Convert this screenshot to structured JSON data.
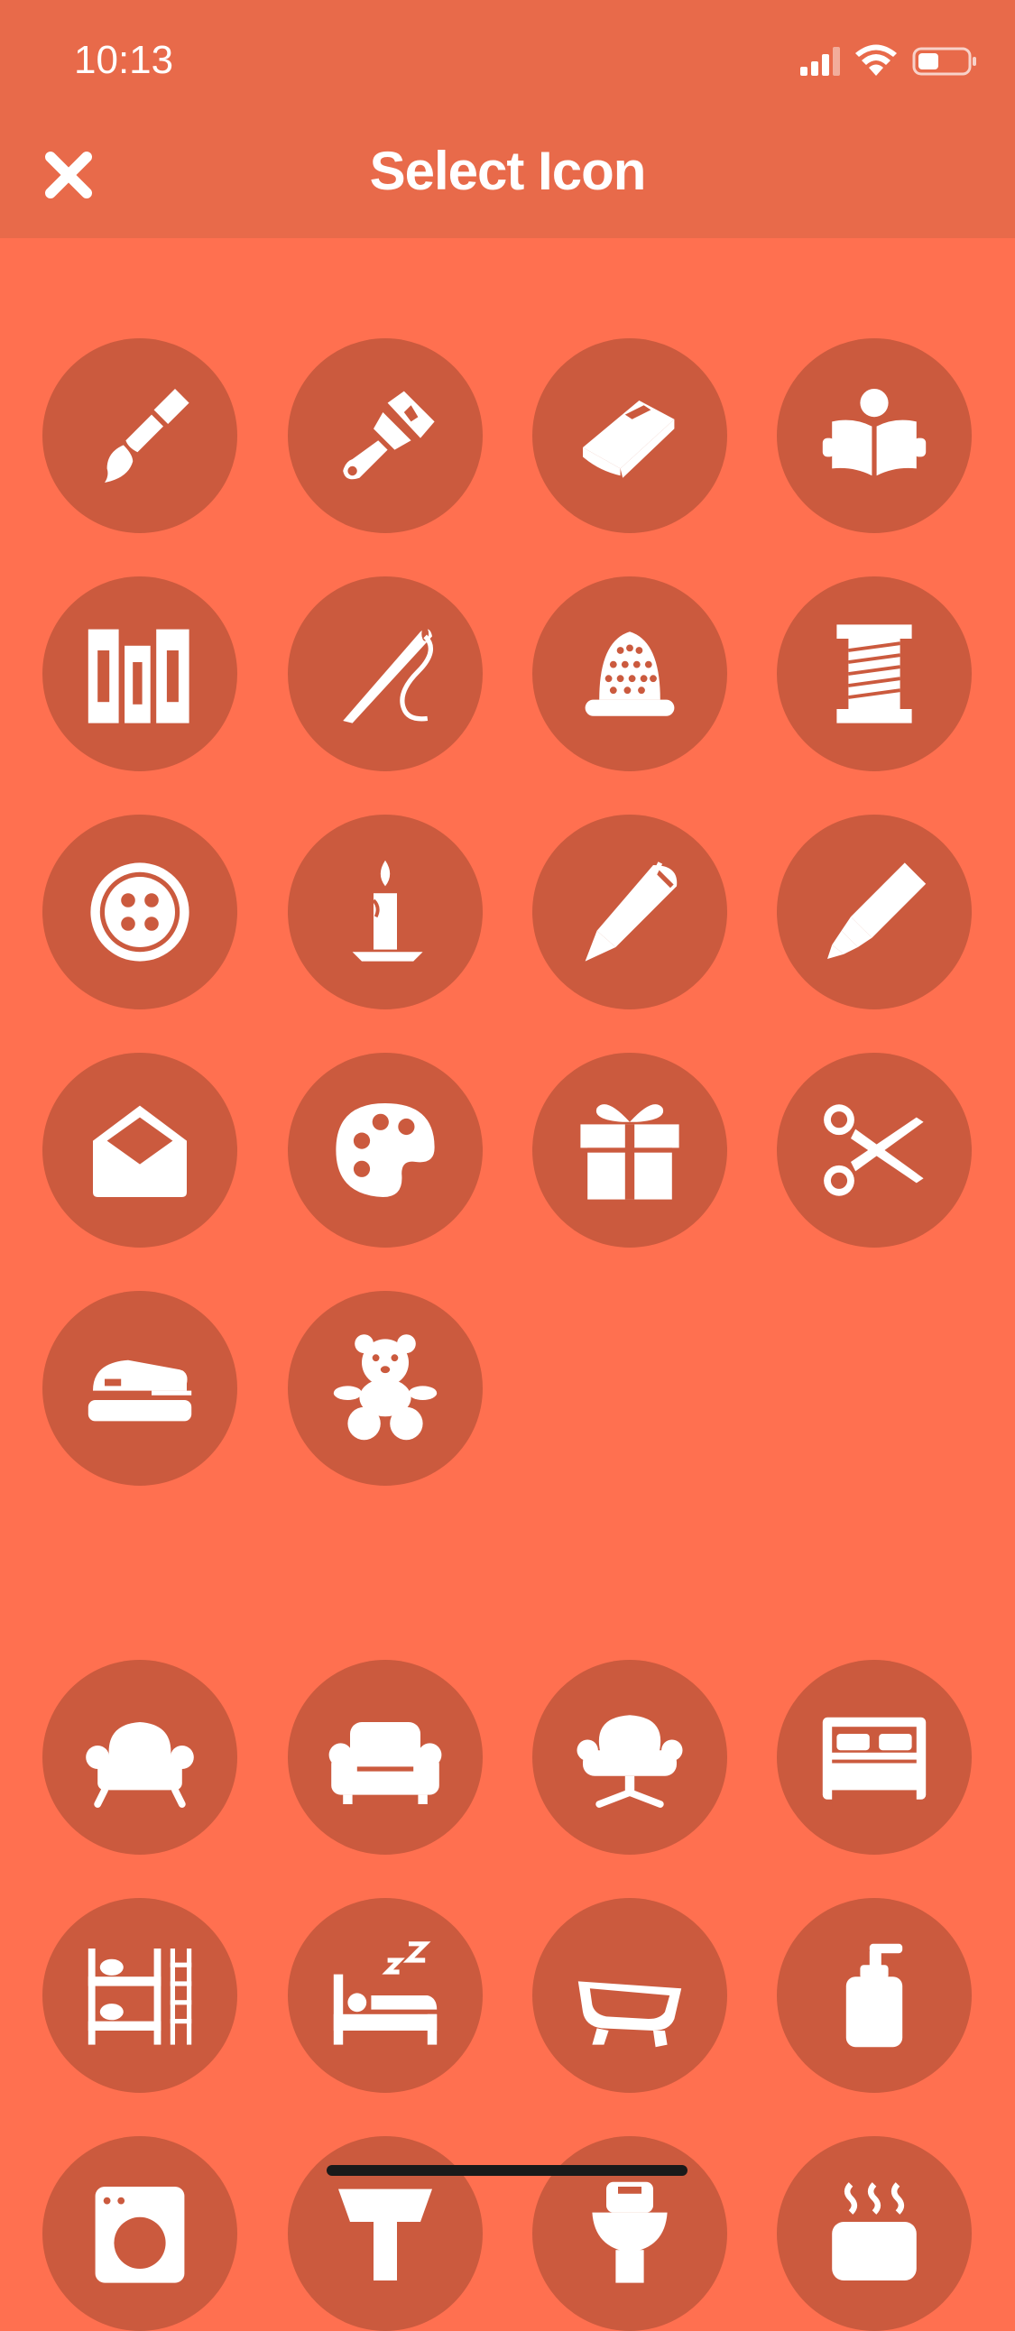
{
  "status_bar": {
    "time": "10:13"
  },
  "header": {
    "title": "Select Icon",
    "close_icon": "close-icon"
  },
  "colors": {
    "header_bg": "#E86A4A",
    "page_bg": "#FF7050",
    "icon_circle": "#CB5A3E",
    "icon_fg": "#FFFFFF"
  },
  "sections": [
    {
      "icons": [
        "paintbrush-icon",
        "paint-roller-brush-icon",
        "book-icon",
        "person-reading-icon",
        "books-shelf-icon",
        "needle-thread-icon",
        "thimble-icon",
        "thread-spool-icon",
        "button-icon",
        "candle-icon",
        "pen-icon",
        "highlighter-icon",
        "envelope-icon",
        "palette-icon",
        "gift-icon",
        "scissors-icon",
        "stapler-icon",
        "teddy-bear-icon"
      ]
    },
    {
      "icons": [
        "armchair-icon",
        "sofa-chair-icon",
        "swivel-chair-icon",
        "double-bed-icon",
        "bunk-bed-icon",
        "sleeping-bed-icon",
        "bathtub-icon",
        "soap-dispenser-icon",
        "washing-machine-icon",
        "sink-icon",
        "toilet-icon",
        "steam-icon"
      ]
    }
  ]
}
